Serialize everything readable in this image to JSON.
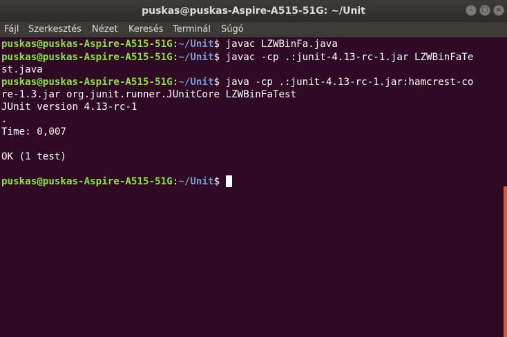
{
  "window": {
    "title": "puskas@puskas-Aspire-A515-51G: ~/Unit",
    "buttons": [
      "minimize",
      "maximize",
      "close"
    ]
  },
  "menu": {
    "items": [
      "Fájl",
      "Szerkesztés",
      "Nézet",
      "Keresés",
      "Terminál",
      "Súgó"
    ]
  },
  "terminal": {
    "prompt": {
      "user_host": "puskas@puskas-Aspire-A515-51G",
      "separator": ":",
      "path": "~/Unit",
      "symbol": "$ "
    },
    "lines": [
      {
        "type": "prompt",
        "command": "javac LZWBinFa.java"
      },
      {
        "type": "prompt",
        "command": "javac -cp .:junit-4.13-rc-1.jar LZWBinFaTe"
      },
      {
        "type": "output",
        "text": "st.java"
      },
      {
        "type": "prompt",
        "command": "java -cp .:junit-4.13-rc-1.jar:hamcrest-co"
      },
      {
        "type": "output",
        "text": "re-1.3.jar org.junit.runner.JUnitCore LZWBinFaTest"
      },
      {
        "type": "output",
        "text": "JUnit version 4.13-rc-1"
      },
      {
        "type": "output",
        "text": "."
      },
      {
        "type": "output",
        "text": "Time: 0,007"
      },
      {
        "type": "output",
        "text": ""
      },
      {
        "type": "output",
        "text": "OK (1 test)"
      },
      {
        "type": "output",
        "text": ""
      },
      {
        "type": "prompt",
        "command": ""
      }
    ]
  },
  "colors": {
    "background": "#300a24",
    "user_host": "#8ae234",
    "path": "#729fcf",
    "text": "#ffffff",
    "scrollbar": "#e95420",
    "titlebar": "#3c3b37"
  }
}
